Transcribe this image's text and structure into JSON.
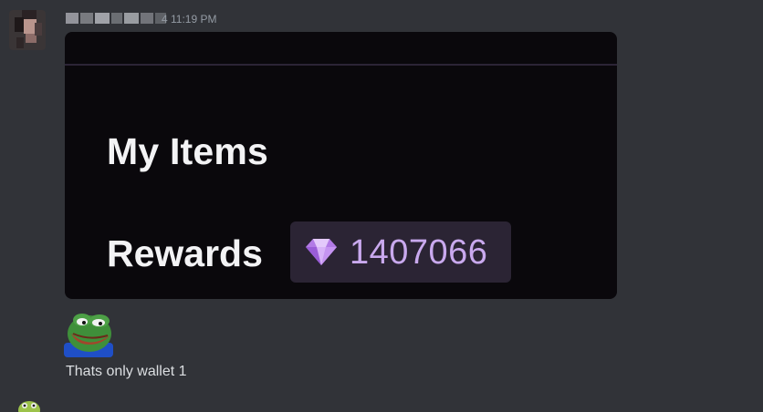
{
  "message": {
    "author_avatar_icon": "user-avatar-icon",
    "timestamp": "4 11:19 PM",
    "text": "Thats only wallet 1",
    "sticker_icon": "pepe-emoji-icon"
  },
  "attachment": {
    "title": "My Items",
    "rewards_label": "Rewards",
    "rewards_icon": "gem-icon",
    "rewards_amount": "1407066",
    "colors": {
      "background": "#0a080c",
      "pill": "#2b2434",
      "amount": "#c9a9ee"
    }
  },
  "next_message": {
    "author_avatar_icon": "user-avatar-icon"
  }
}
